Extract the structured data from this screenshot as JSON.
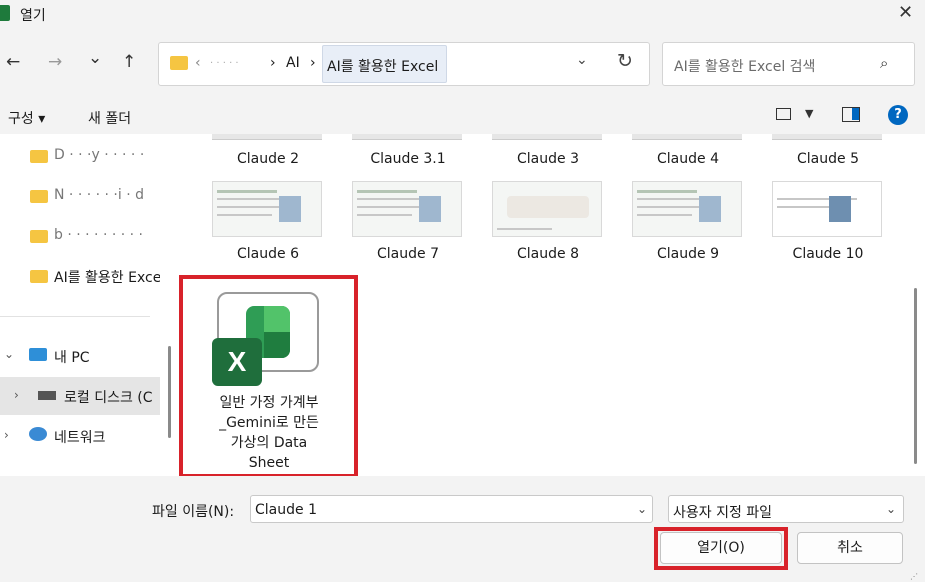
{
  "window": {
    "title": "열기",
    "close_glyph": "✕"
  },
  "nav": {
    "back_glyph": "←",
    "forward_glyph": "→",
    "recent_glyph": "⌄",
    "up_glyph": "↑",
    "crumbs": [
      "‹",
      "· · · · ·",
      "›",
      "AI",
      "›"
    ],
    "current_crumb": "AI를 활용한 Excel",
    "dropdown_glyph": "⌄",
    "refresh_glyph": "↻"
  },
  "search": {
    "placeholder": "AI를 활용한 Excel 검색",
    "icon_glyph": "⌕"
  },
  "toolbar": {
    "organize_label": "구성 ▾",
    "new_folder_label": "새 폴더",
    "view_dropdown_glyph": "▼",
    "help_glyph": "?"
  },
  "sidebar": {
    "folders": [
      {
        "label": "D · · ·y · · · · ·"
      },
      {
        "label": "N · · · · · ·i · d"
      },
      {
        "label": "b · · · · · · · · ·"
      },
      {
        "label": "AI를 활용한 Excel"
      }
    ],
    "this_pc": {
      "label": "내 PC",
      "chevron": "⌄"
    },
    "local_disk": {
      "label": "로컬 디스크 (C",
      "chevron": "›"
    },
    "network": {
      "label": "네트워크",
      "chevron": "›"
    }
  },
  "files": {
    "row1": [
      "Claude 2",
      "Claude 3.1",
      "Claude 3",
      "Claude 4",
      "Claude 5"
    ],
    "row2": [
      "Claude 6",
      "Claude 7",
      "Claude 8",
      "Claude 9",
      "Claude 10"
    ],
    "selected": {
      "icon_letter": "X",
      "label_lines": [
        "일반 가정 가계부",
        "_Gemini로 만든",
        "가상의 Data",
        "Sheet"
      ]
    }
  },
  "bottom": {
    "file_name_label": "파일 이름(N):",
    "file_name_value": "Claude 1",
    "file_type_value": "사용자 지정 파일",
    "open_label": "열기(O)",
    "cancel_label": "취소",
    "dropdown_glyph": "⌄"
  }
}
